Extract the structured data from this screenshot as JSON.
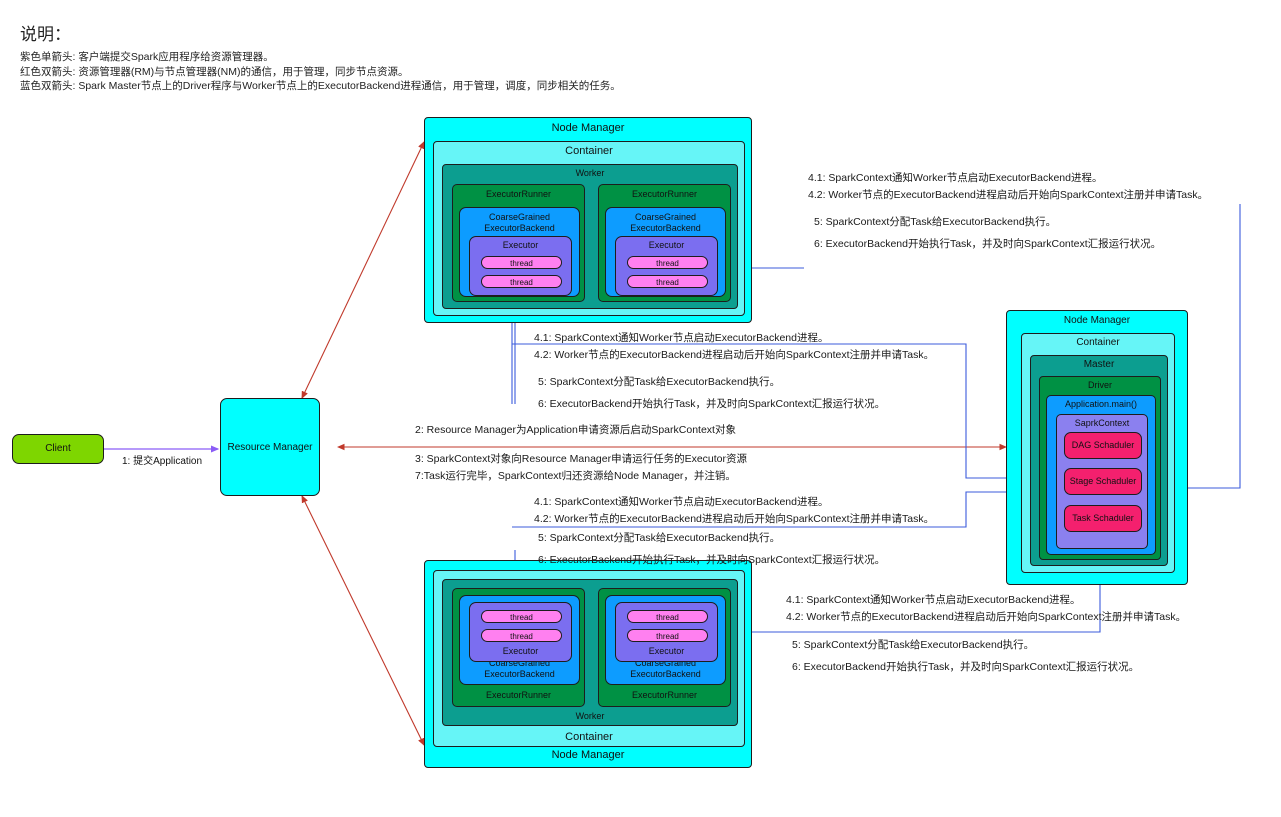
{
  "legend": {
    "title": "说明：",
    "lines": [
      "紫色单箭头: 客户端提交Spark应用程序给资源管理器。",
      "红色双箭头: 资源管理器(RM)与节点管理器(NM)的通信，用于管理，同步节点资源。",
      "蓝色双箭头: Spark Master节点上的Driver程序与Worker节点上的ExecutorBackend进程通信，用于管理，调度，同步相关的任务。"
    ]
  },
  "colors": {
    "node_manager": "#00ffff",
    "container": "#66f5f7",
    "worker": "#0c9e90",
    "executor_runner": "#009144",
    "executor_backend": "#0d9cff",
    "executor": "#7b6ef0",
    "thread": "#ff80f0",
    "scheduler": "#f4206e",
    "client": "#7ed600",
    "purple_arrow": "#8b5cf6",
    "red_arrow": "#c0392b",
    "blue_arrow": "#3b5bdb"
  },
  "client": {
    "label": "Client"
  },
  "resource_manager": {
    "label": "Resource Manager"
  },
  "edge_labels": {
    "submit_application": "1: 提交Application"
  },
  "flow_lines": {
    "step2": "2: Resource Manager为Application申请资源后启动SparkContext对象",
    "step3": "3: SparkContext对象向Resource Manager申请运行任务的Executor资源",
    "step7": "7:Task运行完毕，SparkContext归还资源给Node Manager，并注销。"
  },
  "annotation_block": {
    "line41": "4.1: SparkContext通知Worker节点启动ExecutorBackend进程。",
    "line42": "4.2: Worker节点的ExecutorBackend进程启动后开始向SparkContext注册并申请Task。",
    "line5": "5: SparkContext分配Task给ExecutorBackend执行。",
    "line6": "6: ExecutorBackend开始执行Task，并及时向SparkContext汇报运行状况。"
  },
  "node_manager_top": {
    "node_manager_label": "Node Manager",
    "container_label": "Container",
    "worker_label": "Worker",
    "executor_runners": [
      {
        "label": "ExecutorRunner",
        "backend_line1": "CoarseGrained",
        "backend_line2": "ExecutorBackend",
        "executor_label": "Executor",
        "threads": [
          "thread",
          "thread"
        ]
      },
      {
        "label": "ExecutorRunner",
        "backend_line1": "CoarseGrained",
        "backend_line2": "ExecutorBackend",
        "executor_label": "Executor",
        "threads": [
          "thread",
          "thread"
        ]
      }
    ]
  },
  "node_manager_bottom": {
    "node_manager_label": "Node Manager",
    "container_label": "Container",
    "worker_label": "Worker",
    "executor_runners": [
      {
        "label": "ExecutorRunner",
        "backend_line1": "CoarseGrained",
        "backend_line2": "ExecutorBackend",
        "executor_label": "Executor",
        "threads": [
          "thread",
          "thread"
        ]
      },
      {
        "label": "ExecutorRunner",
        "backend_line1": "CoarseGrained",
        "backend_line2": "ExecutorBackend",
        "executor_label": "Executor",
        "threads": [
          "thread",
          "thread"
        ]
      }
    ]
  },
  "node_manager_master": {
    "node_manager_label": "Node Manager",
    "container_label": "Container",
    "master_label": "Master",
    "driver_label": "Driver",
    "application_label": "Application.main()",
    "spark_context_label": "SaprkContext",
    "schedulers": [
      "DAG Schaduler",
      "Stage Schaduler",
      "Task Schaduler"
    ]
  }
}
